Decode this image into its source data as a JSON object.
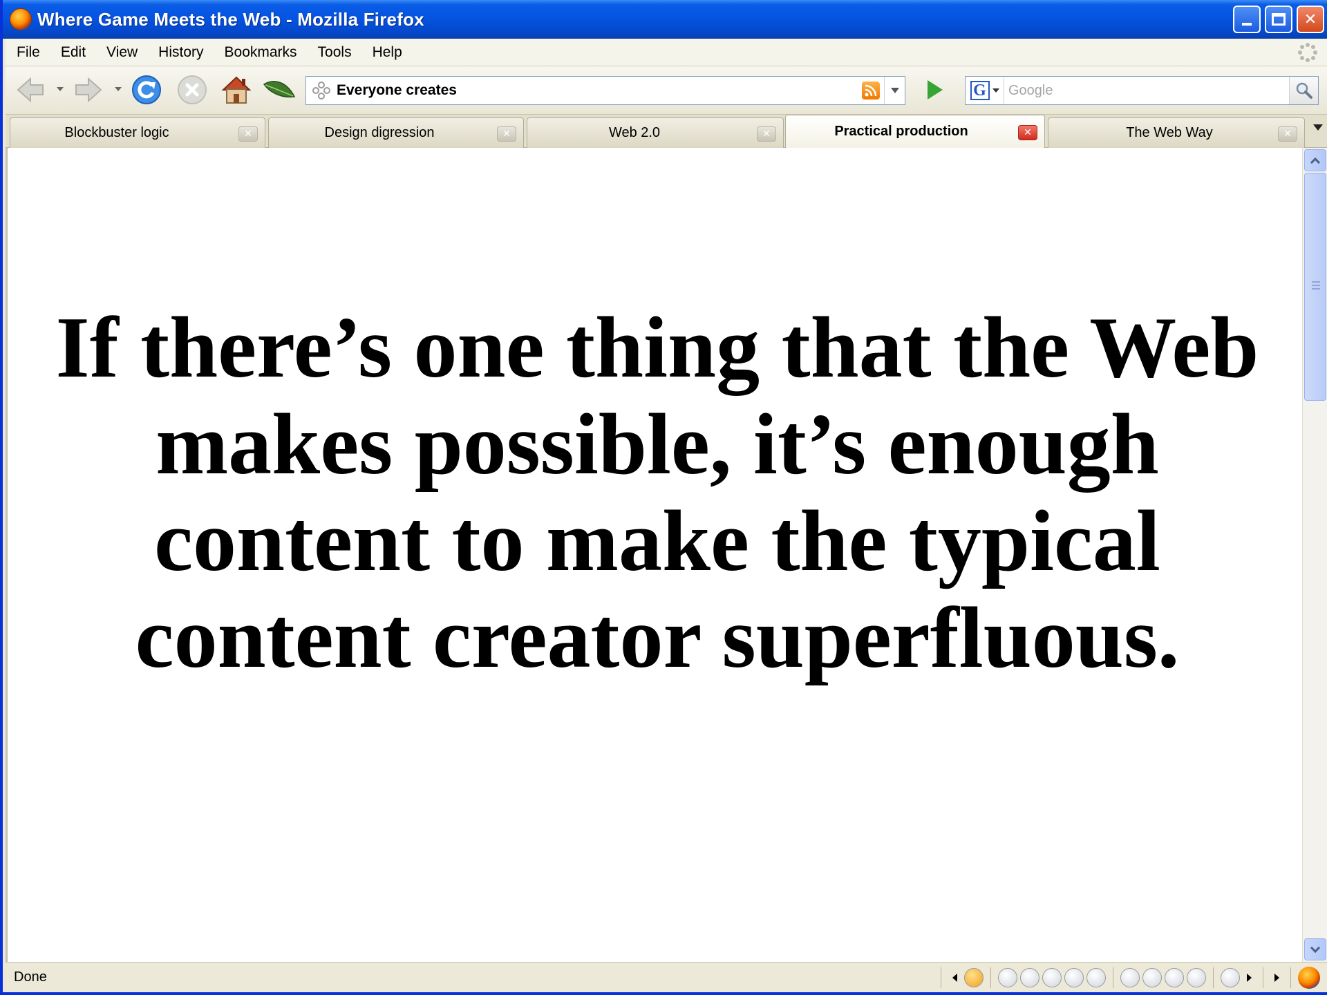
{
  "window": {
    "title": "Where Game Meets the Web - Mozilla Firefox"
  },
  "menu": {
    "items": [
      "File",
      "Edit",
      "View",
      "History",
      "Bookmarks",
      "Tools",
      "Help"
    ]
  },
  "navigation": {
    "url": "Everyone creates",
    "search_placeholder": "Google",
    "search_engine": "G"
  },
  "tabs": [
    {
      "label": "Blockbuster logic",
      "active": false
    },
    {
      "label": "Design digression",
      "active": false
    },
    {
      "label": "Web 2.0",
      "active": false
    },
    {
      "label": "Practical production",
      "active": true
    },
    {
      "label": "The Web Way",
      "active": false
    }
  ],
  "content": {
    "slide_text": "If there’s one thing that the Web makes possible, it’s enough content to make the typical content creator superfluous."
  },
  "status": {
    "text": "Done"
  },
  "colors": {
    "titlebar": "#0553e0",
    "chrome": "#ece9d8",
    "active_tab_close": "#cf2b1d",
    "go_arrow": "#37a533",
    "feed_icon": "#f07800"
  },
  "icons": [
    "firefox-icon",
    "back-arrow-icon",
    "forward-arrow-icon",
    "reload-icon",
    "stop-icon",
    "home-icon",
    "leaf-icon",
    "site-icon",
    "rss-feed-icon",
    "go-arrow-icon",
    "google-icon",
    "magnifier-icon",
    "throbber-icon"
  ]
}
